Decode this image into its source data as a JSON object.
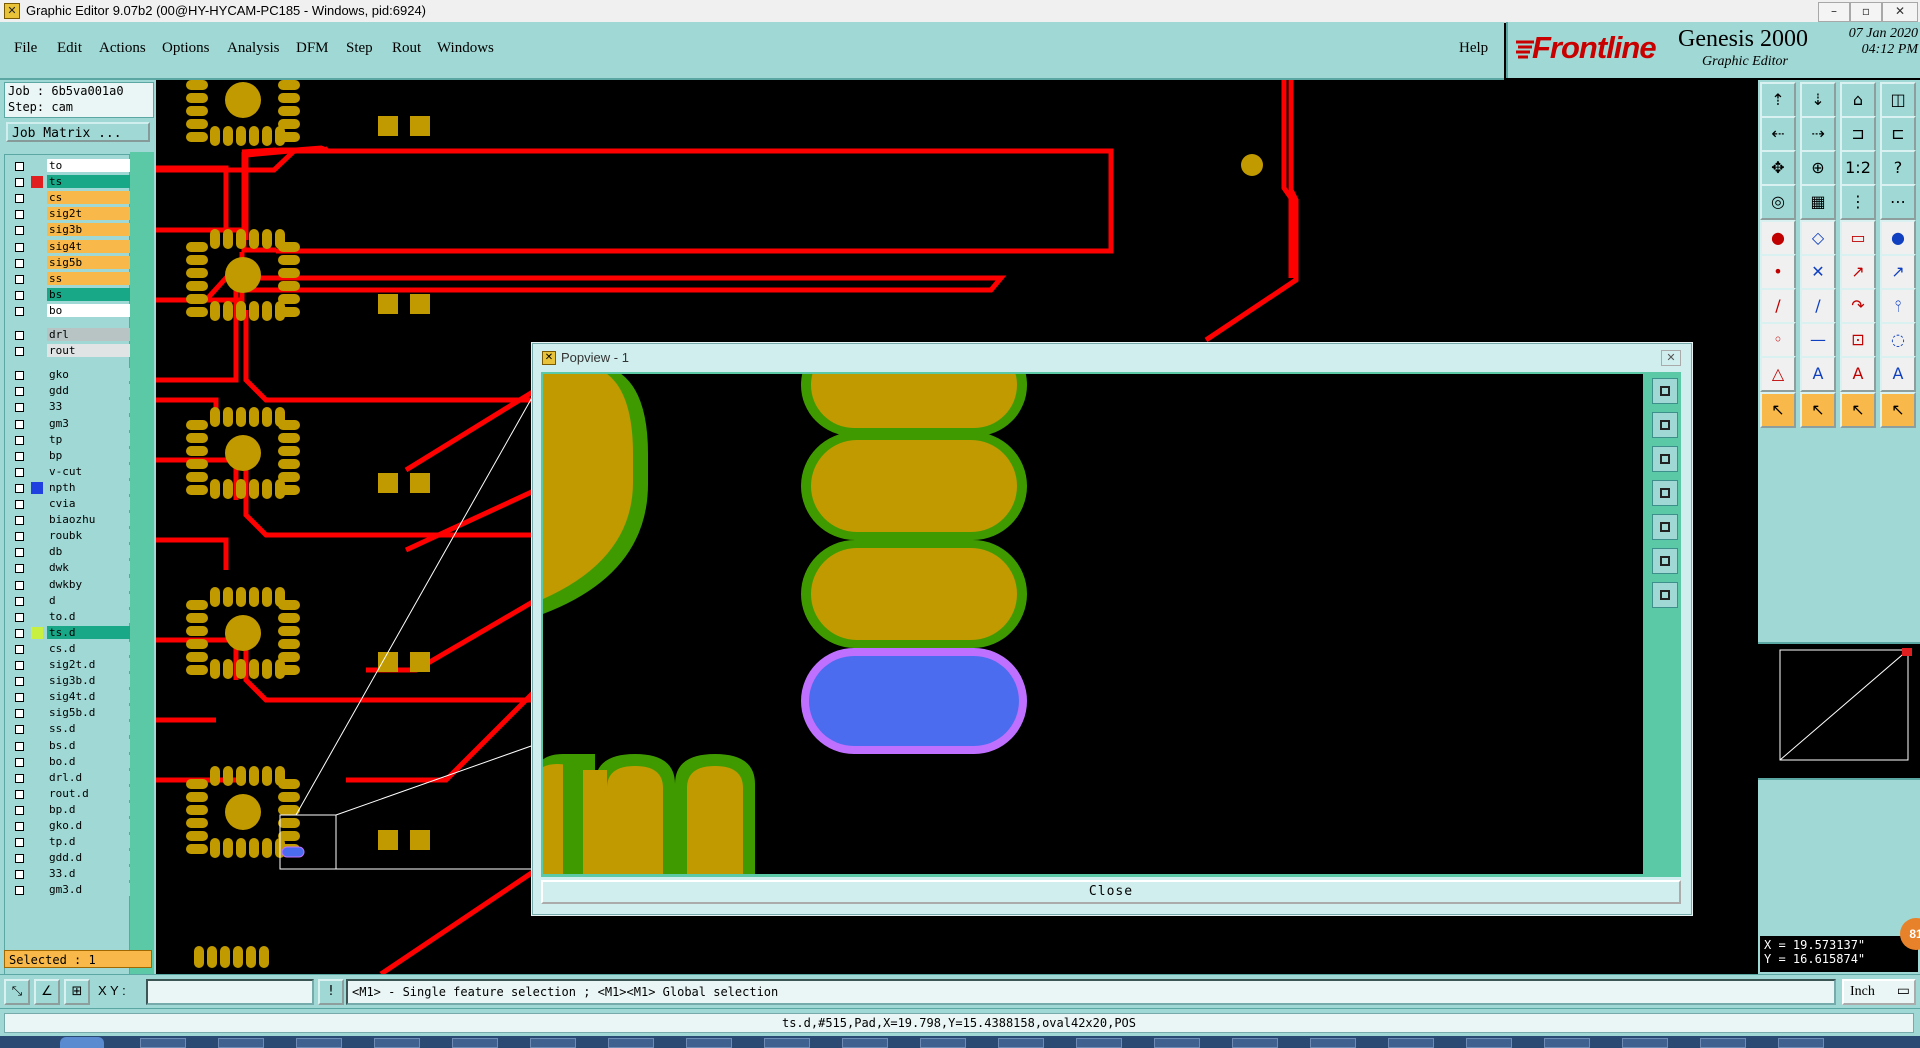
{
  "window": {
    "title": "Graphic Editor 9.07b2 (00@HY-HYCAM-PC185 - Windows, pid:6924)"
  },
  "menu": [
    "File",
    "Edit",
    "Actions",
    "Options",
    "Analysis",
    "DFM",
    "Step",
    "Rout",
    "Windows"
  ],
  "help_label": "Help",
  "brand": {
    "logo": "Frontline",
    "product": "Genesis 2000",
    "subtitle": "Graphic Editor",
    "date": "07 Jan 2020",
    "time": "04:12 PM"
  },
  "job": {
    "job_line": "Job : 6b5va001a0",
    "step_line": "Step: cam",
    "matrix_button": "Job Matrix ..."
  },
  "layers": [
    {
      "name": "to",
      "color": "#ffffff"
    },
    {
      "name": "ts",
      "color": "#18a888",
      "marker": "#e02020"
    },
    {
      "name": "cs",
      "color": "#f8b94a"
    },
    {
      "name": "sig2t",
      "color": "#f8b94a"
    },
    {
      "name": "sig3b",
      "color": "#f8b94a"
    },
    {
      "name": "sig4t",
      "color": "#f8b94a"
    },
    {
      "name": "sig5b",
      "color": "#f8b94a"
    },
    {
      "name": "ss",
      "color": "#f8b94a"
    },
    {
      "name": "bs",
      "color": "#18a888"
    },
    {
      "name": "bo",
      "color": "#ffffff"
    },
    {
      "name": "drl",
      "color": "#b8c4c4"
    },
    {
      "name": "rout",
      "color": "#e0e4e4"
    },
    {
      "name": "gko",
      "color": "#9fd8d4"
    },
    {
      "name": "gdd",
      "color": "#9fd8d4"
    },
    {
      "name": "33",
      "color": "#9fd8d4"
    },
    {
      "name": "gm3",
      "color": "#9fd8d4"
    },
    {
      "name": "tp",
      "color": "#9fd8d4"
    },
    {
      "name": "bp",
      "color": "#9fd8d4"
    },
    {
      "name": "v-cut",
      "color": "#9fd8d4"
    },
    {
      "name": "npth",
      "color": "#9fd8d4",
      "marker": "#2040e0"
    },
    {
      "name": "cvia",
      "color": "#9fd8d4"
    },
    {
      "name": "biaozhu",
      "color": "#9fd8d4"
    },
    {
      "name": "roubk",
      "color": "#9fd8d4"
    },
    {
      "name": "db",
      "color": "#9fd8d4"
    },
    {
      "name": "dwk",
      "color": "#9fd8d4"
    },
    {
      "name": "dwkby",
      "color": "#9fd8d4"
    },
    {
      "name": "d",
      "color": "#9fd8d4"
    },
    {
      "name": "to.d",
      "color": "#9fd8d4"
    },
    {
      "name": "ts.d",
      "color": "#18a888",
      "marker": "#c8f040"
    },
    {
      "name": "cs.d",
      "color": "#9fd8d4"
    },
    {
      "name": "sig2t.d",
      "color": "#9fd8d4"
    },
    {
      "name": "sig3b.d",
      "color": "#9fd8d4"
    },
    {
      "name": "sig4t.d",
      "color": "#9fd8d4"
    },
    {
      "name": "sig5b.d",
      "color": "#9fd8d4"
    },
    {
      "name": "ss.d",
      "color": "#9fd8d4"
    },
    {
      "name": "bs.d",
      "color": "#9fd8d4"
    },
    {
      "name": "bo.d",
      "color": "#9fd8d4"
    },
    {
      "name": "drl.d",
      "color": "#9fd8d4"
    },
    {
      "name": "rout.d",
      "color": "#9fd8d4"
    },
    {
      "name": "bp.d",
      "color": "#9fd8d4"
    },
    {
      "name": "gko.d",
      "color": "#9fd8d4"
    },
    {
      "name": "tp.d",
      "color": "#9fd8d4"
    },
    {
      "name": "gdd.d",
      "color": "#9fd8d4"
    },
    {
      "name": "33.d",
      "color": "#9fd8d4"
    },
    {
      "name": "gm3.d",
      "color": "#9fd8d4"
    }
  ],
  "selected": "Selected : 1",
  "popview": {
    "title": "Popview - 1",
    "close_label": "Close"
  },
  "coords": {
    "x": "X = 19.573137\"",
    "y": "Y = 16.615874\""
  },
  "bubble": "81",
  "command": {
    "xy_label": "X Y :",
    "xy_value": "",
    "hint": "<M1> - Single feature selection ; <M1><M1> Global selection",
    "unit": "Inch"
  },
  "status": "ts.d,#515,Pad,X=19.798,Y=15.4388158,oval42x20,POS",
  "colors": {
    "panel": "#9fd8d4",
    "trace": "#ff0000",
    "pad": "#c19a00",
    "mask": "#3f9a00",
    "selected_pad": "#4c6cf0",
    "selected_outline": "#c070ff"
  }
}
